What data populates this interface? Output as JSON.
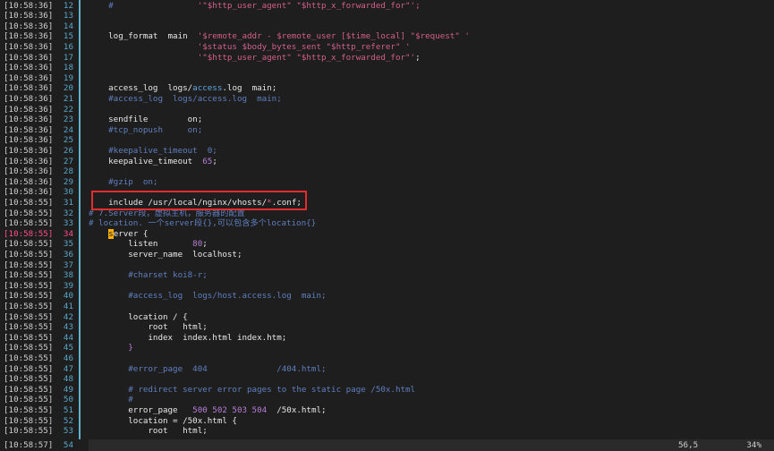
{
  "lines": [
    {
      "ts": "[10:58:36]",
      "ln": "12",
      "parts": [
        {
          "t": "    #",
          "c": "c-cmt"
        },
        {
          "t": "                 '\"$http_user_agent\" \"$http_x_forwarded_for\"';",
          "c": "c-str"
        }
      ]
    },
    {
      "ts": "[10:58:36]",
      "ln": "13",
      "parts": []
    },
    {
      "ts": "[10:58:36]",
      "ln": "14",
      "parts": []
    },
    {
      "ts": "[10:58:36]",
      "ln": "15",
      "parts": [
        {
          "t": "    log_format  main  ",
          "c": "c-kw"
        },
        {
          "t": "'$remote_addr - $remote_user [$time_local] \"$request\" '",
          "c": "c-str"
        }
      ]
    },
    {
      "ts": "[10:58:36]",
      "ln": "16",
      "parts": [
        {
          "t": "                      ",
          "c": "c-kw"
        },
        {
          "t": "'$status $body_bytes_sent \"$http_referer\" '",
          "c": "c-str"
        }
      ]
    },
    {
      "ts": "[10:58:36]",
      "ln": "17",
      "parts": [
        {
          "t": "                      ",
          "c": "c-kw"
        },
        {
          "t": "'\"$http_user_agent\" \"$http_x_forwarded_for\"'",
          "c": "c-str"
        },
        {
          "t": ";",
          "c": "c-kw"
        }
      ]
    },
    {
      "ts": "[10:58:36]",
      "ln": "18",
      "parts": []
    },
    {
      "ts": "[10:58:36]",
      "ln": "19",
      "parts": []
    },
    {
      "ts": "[10:58:36]",
      "ln": "20",
      "parts": [
        {
          "t": "    access_log  logs/",
          "c": "c-kw"
        },
        {
          "t": "access",
          "c": "c-blue"
        },
        {
          "t": ".log  main;",
          "c": "c-kw"
        }
      ]
    },
    {
      "ts": "[10:58:36]",
      "ln": "21",
      "parts": [
        {
          "t": "    #access_log  logs/access.log  main;",
          "c": "c-cmt"
        }
      ]
    },
    {
      "ts": "[10:58:36]",
      "ln": "22",
      "parts": []
    },
    {
      "ts": "[10:58:36]",
      "ln": "23",
      "parts": [
        {
          "t": "    sendfile        on;",
          "c": "c-kw"
        }
      ]
    },
    {
      "ts": "[10:58:36]",
      "ln": "24",
      "parts": [
        {
          "t": "    #tcp_nopush     on;",
          "c": "c-cmt"
        }
      ]
    },
    {
      "ts": "[10:58:36]",
      "ln": "25",
      "parts": []
    },
    {
      "ts": "[10:58:36]",
      "ln": "26",
      "parts": [
        {
          "t": "    #keepalive_timeout  0;",
          "c": "c-cmt"
        }
      ]
    },
    {
      "ts": "[10:58:36]",
      "ln": "27",
      "parts": [
        {
          "t": "    keepalive_timeout  ",
          "c": "c-kw"
        },
        {
          "t": "65",
          "c": "c-num"
        },
        {
          "t": ";",
          "c": "c-kw"
        }
      ]
    },
    {
      "ts": "[10:58:36]",
      "ln": "28",
      "parts": []
    },
    {
      "ts": "[10:58:36]",
      "ln": "29",
      "parts": [
        {
          "t": "    #gzip  on;",
          "c": "c-cmt"
        }
      ]
    },
    {
      "ts": "[10:58:36]",
      "ln": "30",
      "parts": []
    },
    {
      "ts": "[10:58:55]",
      "ln": "31",
      "parts": [
        {
          "t": "    include /usr/local/nginx/vhosts/",
          "c": "c-kw"
        },
        {
          "t": "*",
          "c": "c-star"
        },
        {
          "t": ".conf;",
          "c": "c-kw"
        }
      ]
    },
    {
      "ts": "[10:58:55]",
      "ln": "32",
      "parts": [
        {
          "t": "# 7.Server段，虚拟主机，服务器的配置",
          "c": "c-cmt"
        }
      ]
    },
    {
      "ts": "[10:58:55]",
      "ln": "33",
      "parts": [
        {
          "t": "# location. 一个server段{},可以包含多个location{}",
          "c": "c-cmt"
        }
      ]
    },
    {
      "ts": "[10:58:55]",
      "ln": "34",
      "current": true,
      "cursor": true,
      "parts": [
        {
          "t": "    ",
          "c": "c-kw"
        },
        {
          "t": "s",
          "c": "cursor"
        },
        {
          "t": "erver {",
          "c": "c-kw"
        }
      ]
    },
    {
      "ts": "[10:58:55]",
      "ln": "35",
      "parts": [
        {
          "t": "        listen       ",
          "c": "c-kw"
        },
        {
          "t": "80",
          "c": "c-num"
        },
        {
          "t": ";",
          "c": "c-kw"
        }
      ]
    },
    {
      "ts": "[10:58:55]",
      "ln": "36",
      "parts": [
        {
          "t": "        server_name  localhost;",
          "c": "c-kw"
        }
      ]
    },
    {
      "ts": "[10:58:55]",
      "ln": "37",
      "parts": []
    },
    {
      "ts": "[10:58:55]",
      "ln": "38",
      "parts": [
        {
          "t": "        #charset koi8-r;",
          "c": "c-cmt"
        }
      ]
    },
    {
      "ts": "[10:58:55]",
      "ln": "39",
      "parts": []
    },
    {
      "ts": "[10:58:55]",
      "ln": "40",
      "parts": [
        {
          "t": "        #access_log  logs/host.access.log  main;",
          "c": "c-cmt"
        }
      ]
    },
    {
      "ts": "[10:58:55]",
      "ln": "41",
      "parts": []
    },
    {
      "ts": "[10:58:55]",
      "ln": "42",
      "parts": [
        {
          "t": "        location / {",
          "c": "c-kw"
        }
      ]
    },
    {
      "ts": "[10:58:55]",
      "ln": "43",
      "parts": [
        {
          "t": "            root   html;",
          "c": "c-kw"
        }
      ]
    },
    {
      "ts": "[10:58:55]",
      "ln": "44",
      "parts": [
        {
          "t": "            index  index.html index.htm;",
          "c": "c-kw"
        }
      ]
    },
    {
      "ts": "[10:58:55]",
      "ln": "45",
      "parts": [
        {
          "t": "        }",
          "c": "c-num"
        }
      ]
    },
    {
      "ts": "[10:58:55]",
      "ln": "46",
      "parts": []
    },
    {
      "ts": "[10:58:55]",
      "ln": "47",
      "parts": [
        {
          "t": "        #error_page  404              /404.html;",
          "c": "c-cmt"
        }
      ]
    },
    {
      "ts": "[10:58:55]",
      "ln": "48",
      "parts": []
    },
    {
      "ts": "[10:58:55]",
      "ln": "49",
      "parts": [
        {
          "t": "        # redirect server error pages to the static page /50x.html",
          "c": "c-cmt"
        }
      ]
    },
    {
      "ts": "[10:58:55]",
      "ln": "50",
      "parts": [
        {
          "t": "        #",
          "c": "c-cmt"
        }
      ]
    },
    {
      "ts": "[10:58:55]",
      "ln": "51",
      "parts": [
        {
          "t": "        error_page   ",
          "c": "c-kw"
        },
        {
          "t": "500 502 503 504",
          "c": "c-num"
        },
        {
          "t": "  /50x.html;",
          "c": "c-kw"
        }
      ]
    },
    {
      "ts": "[10:58:55]",
      "ln": "52",
      "parts": [
        {
          "t": "        location = /50x.html {",
          "c": "c-kw"
        }
      ]
    },
    {
      "ts": "[10:58:55]",
      "ln": "53",
      "parts": [
        {
          "t": "            root   html;",
          "c": "c-kw"
        }
      ]
    }
  ],
  "status": {
    "ts": "[10:58:57]",
    "ln": "54",
    "position": "56,5",
    "percent": "34%"
  }
}
